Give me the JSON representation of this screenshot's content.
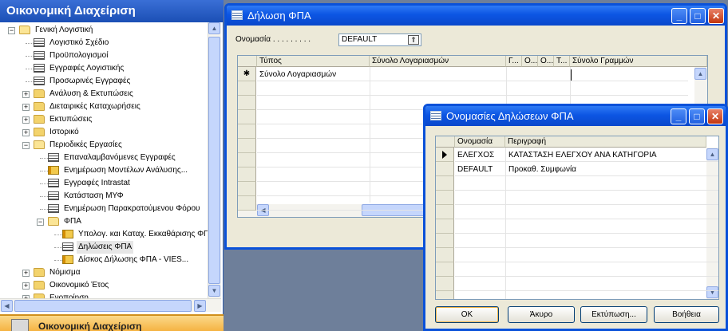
{
  "nav": {
    "title": "Οικονομική Διαχείριση",
    "footer": "Οικονομική Διαχείριση",
    "tree": [
      {
        "label": "Γενική Λογιστική",
        "icon": "folder-open-icon",
        "type": "folder",
        "expander": "−"
      },
      {
        "label": "Λογιστικό Σχέδιο",
        "icon": "list-form-icon",
        "type": "list"
      },
      {
        "label": "Προϋπολογισμοί",
        "icon": "list-form-icon",
        "type": "list"
      },
      {
        "label": "Εγγραφές Λογιστικής",
        "icon": "list-form-icon",
        "type": "list"
      },
      {
        "label": "Προσωρινές Εγγραφές",
        "icon": "list-form-icon",
        "type": "list"
      },
      {
        "label": "Ανάλυση & Εκτυπώσεις",
        "icon": "folder-icon",
        "type": "folder",
        "expander": "+"
      },
      {
        "label": "Διεταιρικές Καταχωρήσεις",
        "icon": "folder-icon",
        "type": "folder",
        "expander": "+"
      },
      {
        "label": "Εκτυπώσεις",
        "icon": "folder-icon",
        "type": "folder",
        "expander": "+"
      },
      {
        "label": "Ιστορικό",
        "icon": "folder-icon",
        "type": "folder",
        "expander": "+"
      },
      {
        "label": "Περιοδικές Εργασίες",
        "icon": "folder-open-icon",
        "type": "folder",
        "expander": "−"
      },
      {
        "label": "Επαναλαμβανόμενες Εγγραφές",
        "icon": "list-form-icon",
        "type": "list"
      },
      {
        "label": "Ενημέρωση Μοντέλων Ανάλυσης...",
        "icon": "report-icon",
        "type": "report"
      },
      {
        "label": "Εγγραφές Intrastat",
        "icon": "list-form-icon",
        "type": "list"
      },
      {
        "label": "Κατάσταση ΜΥΦ",
        "icon": "list-form-icon",
        "type": "list"
      },
      {
        "label": "Ενημέρωση Παρακρατούμενου Φόρου",
        "icon": "list-form-icon",
        "type": "list"
      },
      {
        "label": "ΦΠΑ",
        "icon": "folder-open-icon",
        "type": "folder",
        "expander": "−"
      },
      {
        "label": "Υπολογ. και Καταχ. Εκκαθάρισης ΦΠΑ",
        "icon": "report-icon",
        "type": "report"
      },
      {
        "label": "Δηλώσεις ΦΠΑ",
        "icon": "list-form-icon",
        "type": "list",
        "selected": true
      },
      {
        "label": "Δίσκος Δήλωσης ΦΠΑ - VIES...",
        "icon": "report-icon",
        "type": "report"
      },
      {
        "label": "Νόμισμα",
        "icon": "folder-icon",
        "type": "folder",
        "expander": "+"
      },
      {
        "label": "Οικονομικό Έτος",
        "icon": "folder-icon",
        "type": "folder",
        "expander": "+"
      },
      {
        "label": "Ενοποίηση",
        "icon": "folder-icon",
        "type": "folder",
        "expander": "+"
      }
    ]
  },
  "vat_statement": {
    "title": "Δήλωση ΦΠΑ",
    "name_label": "Ονομασία . . . . . . . . .",
    "name_value": "DEFAULT",
    "columns": [
      "Τύπος",
      "Σύνολο Λογαριασμών",
      "Γ...",
      "Ο...",
      "Ο...",
      "Τ...",
      "Σύνολο Γραμμών"
    ],
    "rows": [
      {
        "marker": "✱",
        "type": "Σύνολο Λογαριασμών",
        "account_totaling": "",
        "row_totaling": ""
      }
    ]
  },
  "vat_statement_names": {
    "title": "Ονομασίες Δηλώσεων ΦΠΑ",
    "columns": [
      "Ονομασία",
      "Περιγραφή"
    ],
    "rows": [
      {
        "name": "ΕΛΕΓΧΟΣ",
        "description": "ΚΑΤΑΣΤΑΣΗ ΕΛΕΓΧΟΥ ΑΝΑ ΚΑΤΗΓΟΡΙΑ",
        "current": true
      },
      {
        "name": "DEFAULT",
        "description": "Προκαθ. Συμφωνία",
        "current": false
      }
    ],
    "buttons": {
      "ok": "OK",
      "cancel": "Άκυρο",
      "print": "Εκτύπωση...",
      "help": "Βοήθεια"
    }
  },
  "window_buttons": {
    "minimize": "_",
    "maximize": "□",
    "close": "✕"
  }
}
